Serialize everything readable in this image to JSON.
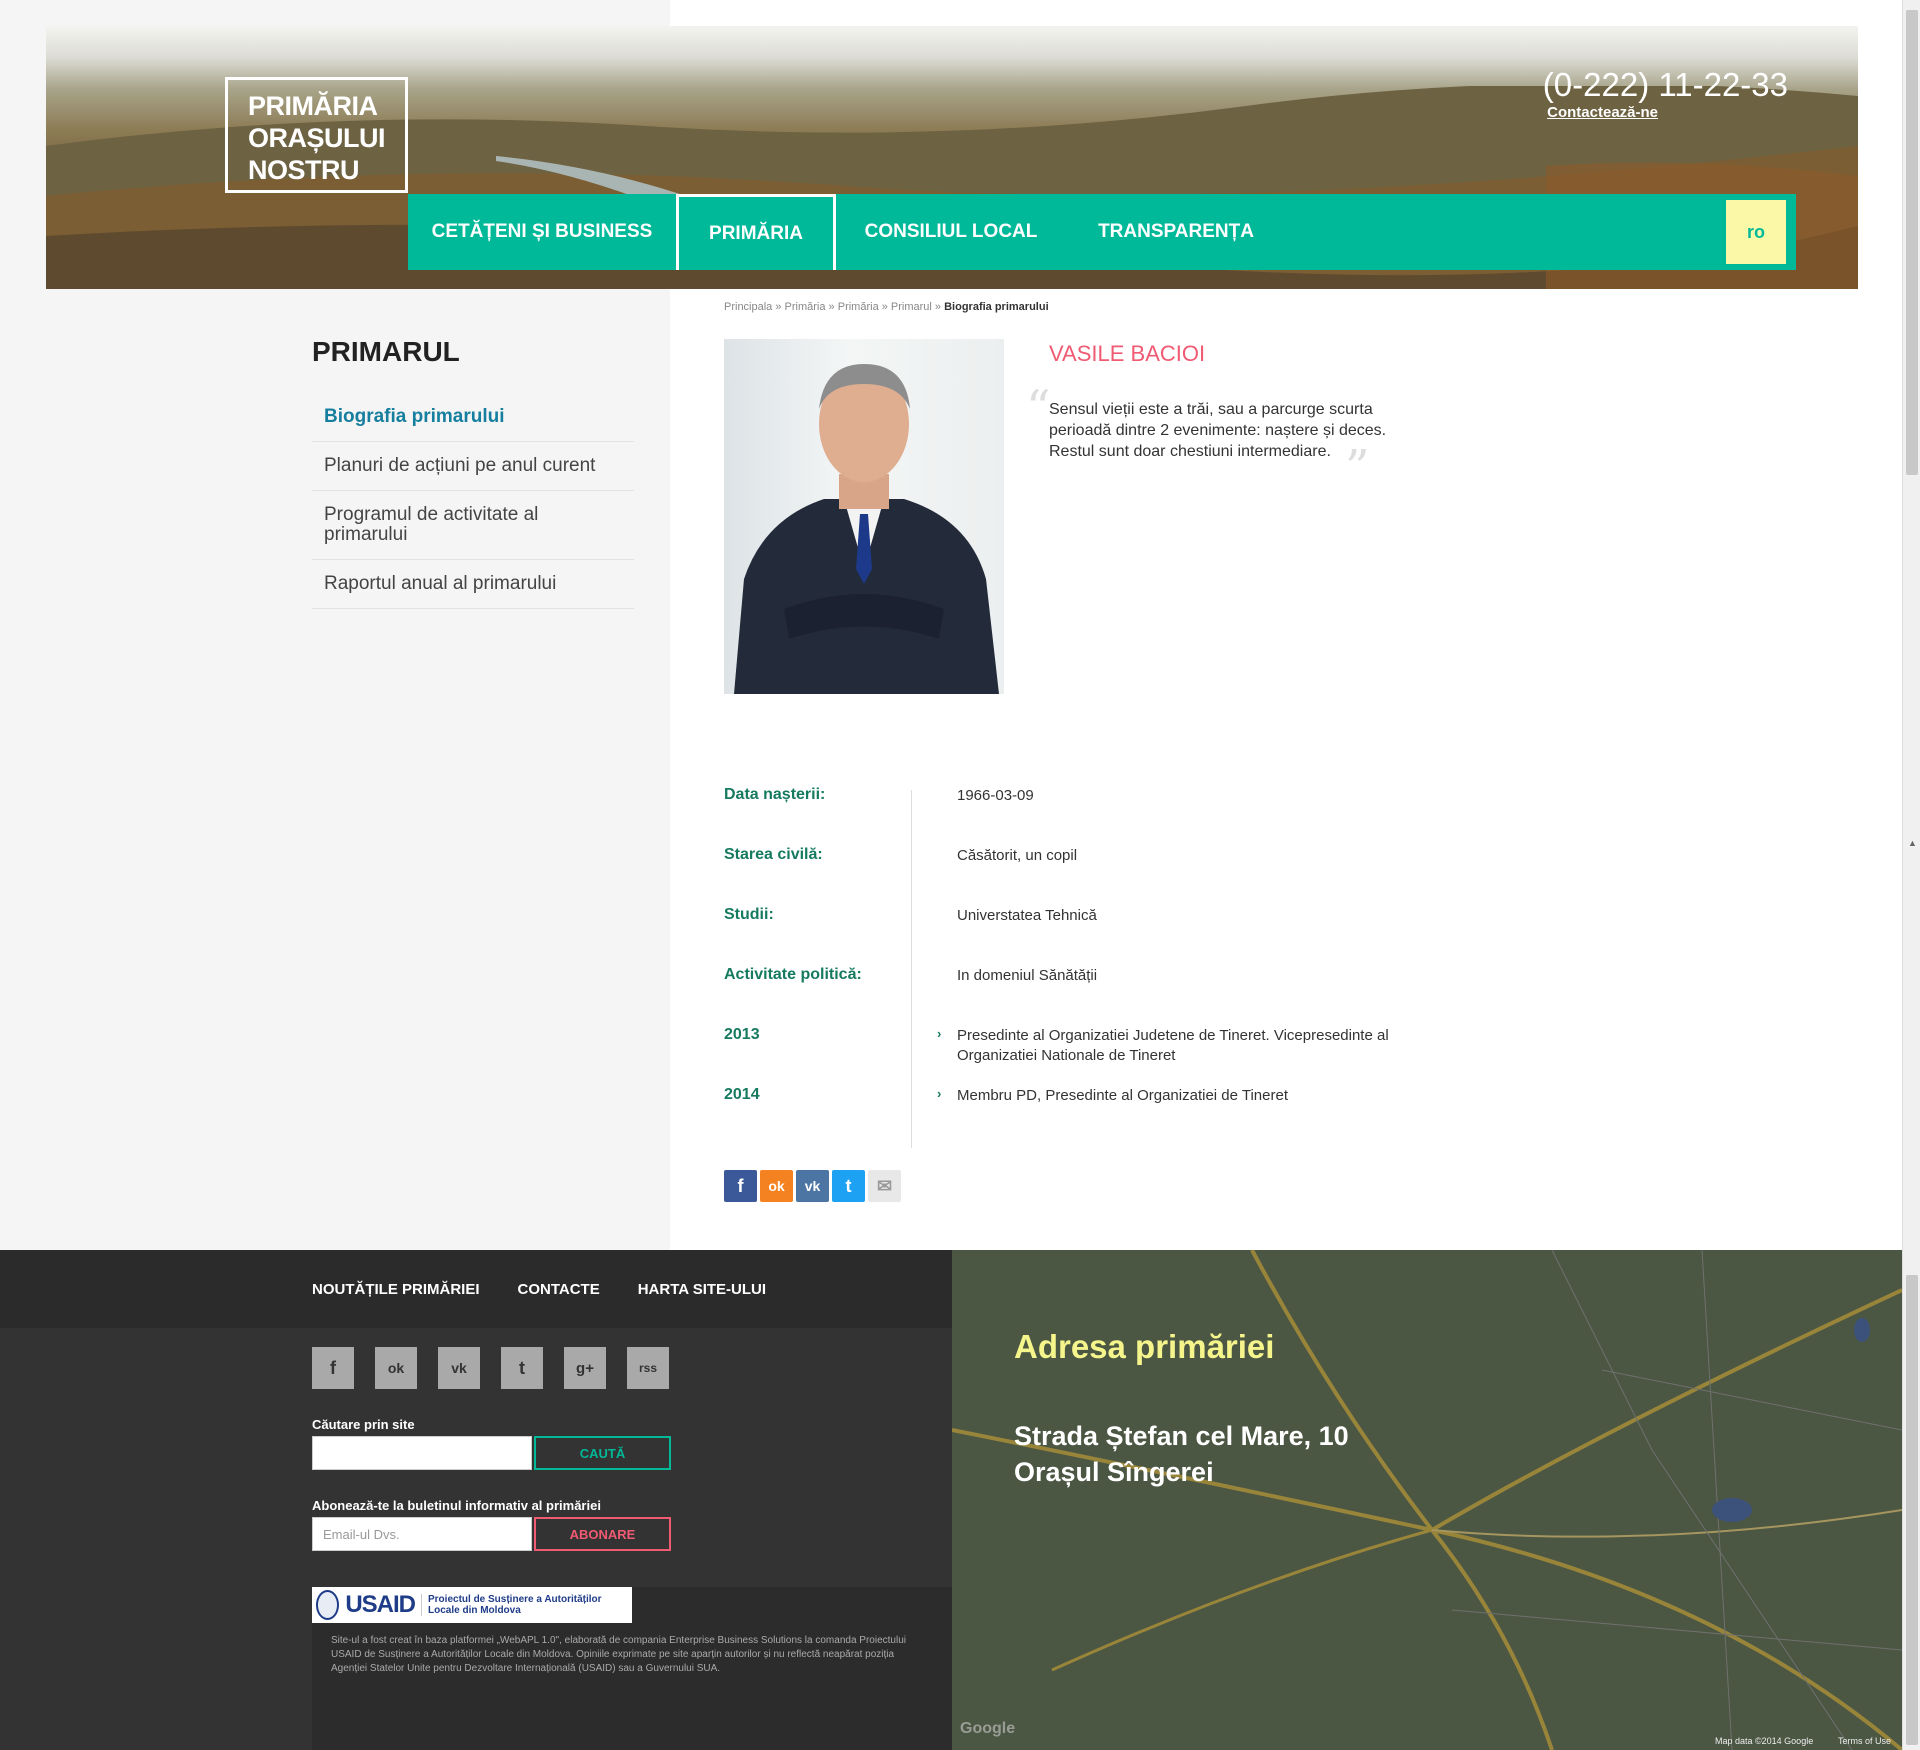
{
  "header": {
    "logo_lines": [
      "PRIMĂRIA",
      "ORAȘULUI",
      "NOSTRU"
    ],
    "phone": "(0-222) 11-22-33",
    "contact_link": "Contactează-ne",
    "nav": [
      "CETĂȚENI ȘI BUSINESS",
      "PRIMĂRIA",
      "CONSILIUL LOCAL",
      "TRANSPARENȚA"
    ],
    "language": "ro"
  },
  "breadcrumb": {
    "items": [
      "Principala",
      "Primăria",
      "Primăria",
      "Primarul"
    ],
    "current": "Biografia primarului"
  },
  "sidebar": {
    "title": "PRIMARUL",
    "items": [
      {
        "label": "Biografia primarului",
        "active": true
      },
      {
        "label": "Planuri de acțiuni pe anul curent",
        "active": false
      },
      {
        "label": "Programul de activitate al primarului",
        "active": false
      },
      {
        "label": "Raportul anual al primarului",
        "active": false
      }
    ]
  },
  "profile": {
    "name": "VASILE BACIOI",
    "quote": "Sensul vieții este a trăi, sau a parcurge scurta perioadă dintre 2 evenimente: naștere și deces. Restul sunt doar chestiuni intermediare."
  },
  "details": [
    {
      "label": "Data nașterii:",
      "value": "1966-03-09",
      "bullet": false
    },
    {
      "label": "Starea civilă:",
      "value": "Căsătorit, un copil",
      "bullet": false
    },
    {
      "label": "Studii:",
      "value": "Universtatea Tehnică",
      "bullet": false
    },
    {
      "label": "Activitate politică:",
      "value": "In domeniul Sănătății",
      "bullet": false
    },
    {
      "label": "2013",
      "value": "Presedinte al Organizatiei Judetene de Tineret. Vicepresedinte al Organizatiei Nationale de Tineret",
      "bullet": true
    },
    {
      "label": "2014",
      "value": "Membru PD, Presedinte al Organizatiei de Tineret",
      "bullet": true
    }
  ],
  "share_icons": [
    "facebook-icon",
    "odnoklassniki-icon",
    "vk-icon",
    "twitter-icon",
    "email-icon"
  ],
  "footer": {
    "links": [
      "NOUTĂȚILE PRIMĂRIEI",
      "CONTACTE",
      "HARTA SITE-ULUI"
    ],
    "social": [
      {
        "name": "facebook-icon",
        "glyph": "f"
      },
      {
        "name": "odnoklassniki-icon",
        "glyph": "ok"
      },
      {
        "name": "vk-icon",
        "glyph": "vk"
      },
      {
        "name": "twitter-icon",
        "glyph": "t"
      },
      {
        "name": "google-plus-icon",
        "glyph": "g+"
      },
      {
        "name": "rss-icon",
        "glyph": "rss"
      }
    ],
    "search_label": "Căutare prin site",
    "search_button": "CAUTĂ",
    "subscribe_label": "Abonează-te la buletinul informativ al primăriei",
    "subscribe_placeholder": "Email-ul Dvs.",
    "subscribe_button": "ABONARE",
    "usaid_brand": "USAID",
    "usaid_project": "Proiectul de Susținere a Autorităților Locale din Moldova",
    "disclaimer": "Site-ul a fost creat în baza platformei „WebAPL 1.0\", elaborată de compania Enterprise Business Solutions la comanda Proiectului USAID de Susținere a Autorităților Locale din Moldova. Opiniile exprimate pe site aparțin autorilor și nu reflectă neapărat poziția Agenției Statelor Unite pentru Dezvoltare Internațională (USAID) sau a Guvernului SUA."
  },
  "map": {
    "title": "Adresa primăriei",
    "address_lines": [
      "Strada Ștefan cel Mare, 10",
      "Orașul Sîngerei"
    ],
    "credit": "Map data ©2014 Google",
    "terms": "Terms of Use"
  },
  "colors": {
    "accent": "#00b998",
    "name_pink": "#f05a72",
    "link_blue": "#167e9f",
    "label_green": "#167a5f",
    "lang_yellow": "#fbf9a8",
    "map_title": "#f5f58c"
  }
}
